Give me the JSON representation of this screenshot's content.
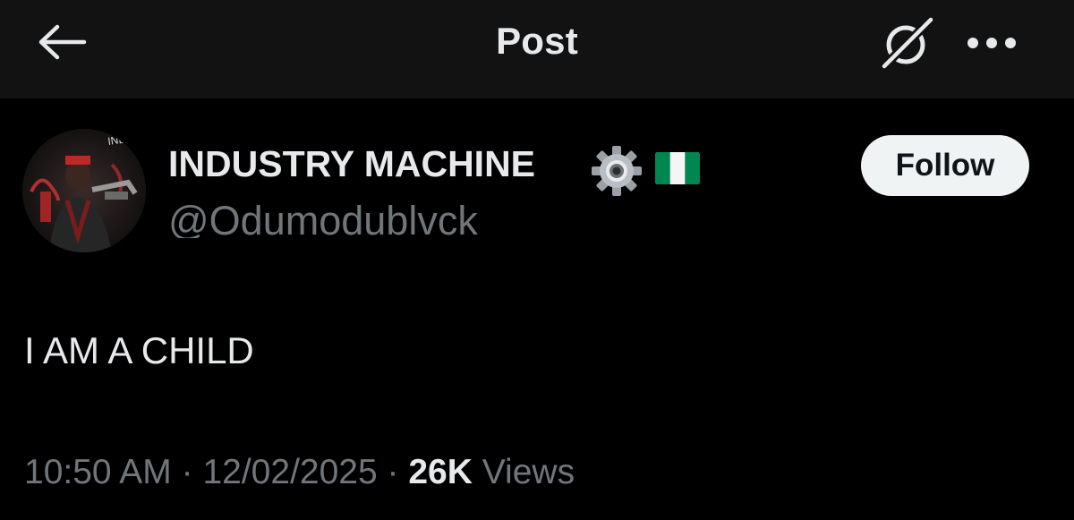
{
  "header": {
    "title": "Post",
    "back_icon": "arrow-left-icon",
    "grok_icon": "grok-icon",
    "more_icon": "more-horizontal-icon"
  },
  "author": {
    "name": "INDUSTRY MACHINE",
    "name_emoji_1": "gear-icon",
    "name_emoji_2": "nigeria-flag-icon",
    "handle": "@Odumodublvck",
    "follow_label": "Follow",
    "avatar_text": "INDUS MACHIN"
  },
  "post": {
    "text": "I AM A CHILD"
  },
  "meta": {
    "time": "10:50 AM",
    "date": "12/02/2025",
    "views_count": "26K",
    "views_label": "Views",
    "separator": "·"
  },
  "colors": {
    "background": "#000000",
    "header_bg": "#121212",
    "primary_text": "#e7e9ea",
    "secondary_text": "#71767b",
    "follow_bg": "#eff3f4",
    "flag_green": "#008751"
  }
}
